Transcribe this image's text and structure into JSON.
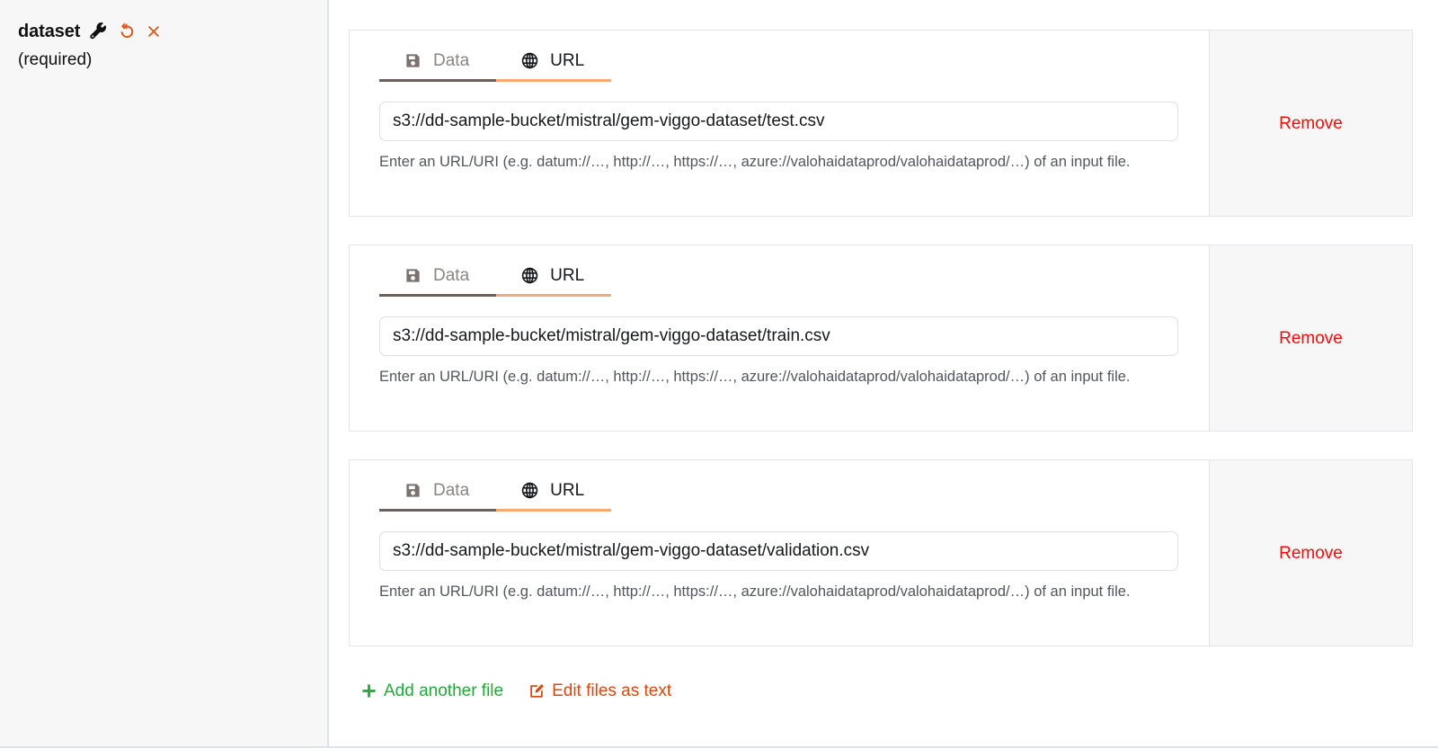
{
  "parameter": {
    "name": "dataset",
    "required_label": "(required)",
    "icons": {
      "settings": "wrench-icon",
      "reset": "undo-icon",
      "remove": "close-x-icon"
    },
    "colors": {
      "accent_orange": "#e2500f",
      "remove_red": "#fb0707",
      "add_green": "#24a83c",
      "edit_orange": "#d9480f",
      "active_tab_underline": "#f6a878",
      "inactive_tab_underline": "#6a615e",
      "sidebar_bg": "#f7f7f7"
    }
  },
  "tabs": {
    "data_label": "Data",
    "url_label": "URL",
    "data_icon": "floppy-disk-icon",
    "url_icon": "globe-icon",
    "active": "URL"
  },
  "help_text": "Enter an URL/URI (e.g. datum://…, http://…, https://…, azure://valohaidataprod/valohaidataprod/…) of an input file.",
  "url_placeholder": "",
  "remove_label": "Remove",
  "files": [
    {
      "url": "s3://dd-sample-bucket/mistral/gem-viggo-dataset/test.csv"
    },
    {
      "url": "s3://dd-sample-bucket/mistral/gem-viggo-dataset/train.csv"
    },
    {
      "url": "s3://dd-sample-bucket/mistral/gem-viggo-dataset/validation.csv"
    }
  ],
  "actions": {
    "add_label": "Add another file",
    "add_icon": "plus-icon",
    "edit_label": "Edit files as text",
    "edit_icon": "pencil-square-icon"
  }
}
